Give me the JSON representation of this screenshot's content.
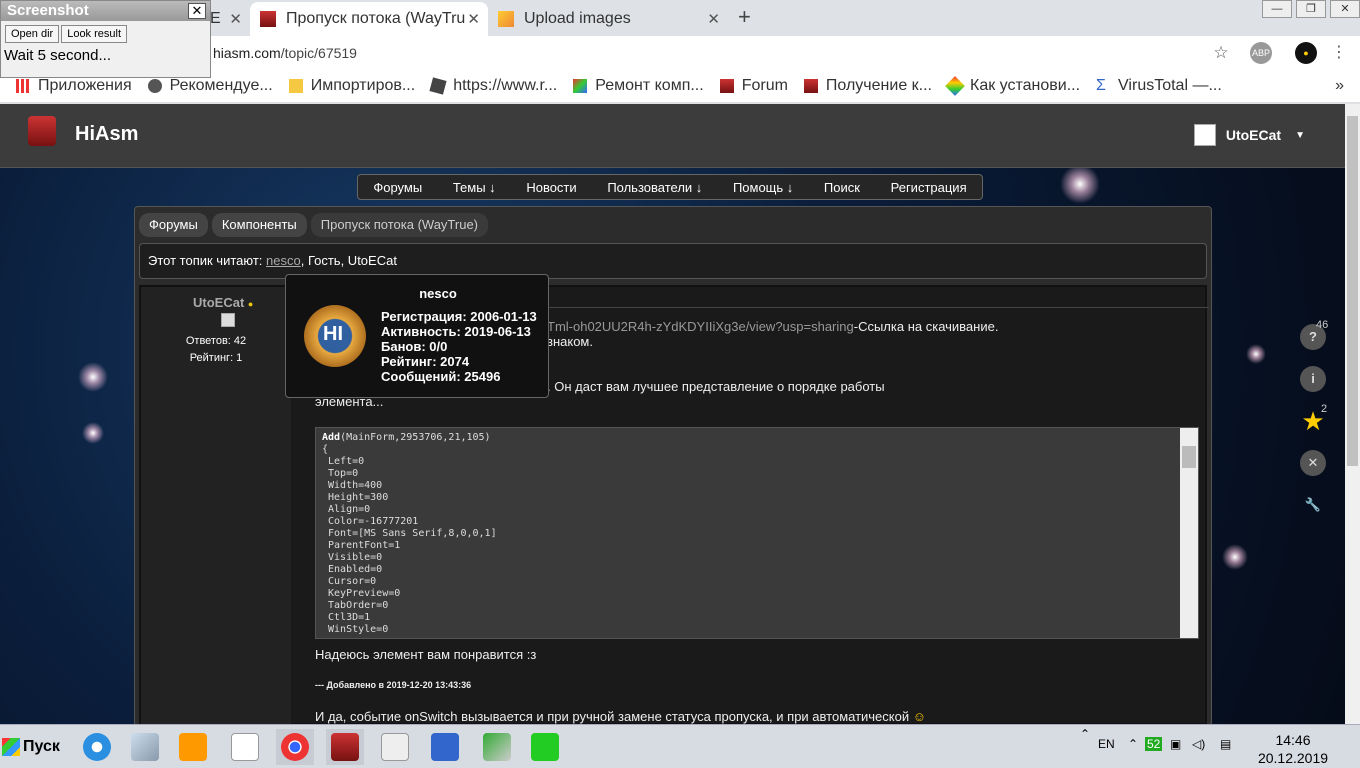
{
  "browser": {
    "tabs": [
      {
        "label": "E",
        "partial": true
      },
      {
        "label": "Пропуск потока (WayTru"
      },
      {
        "label": "Upload images"
      }
    ],
    "url_prefix": "hiasm.com",
    "url_path": "/topic/67519",
    "abp_label": "ABP",
    "bookmarks": [
      "Приложения",
      "Рекомендуе...",
      "Импортиров...",
      "https://www.r...",
      "Ремонт комп...",
      "Forum",
      "Получение к...",
      "Как установи...",
      "VirusTotal —..."
    ],
    "more_bookmarks": "»"
  },
  "screenshot_tool": {
    "title": "Screenshot",
    "open_dir": "Open dir",
    "look_result": "Look result",
    "status": "Wait 5 second..."
  },
  "site": {
    "brand": "HiAsm",
    "user": "UtoECat",
    "user_caret": "▼",
    "nav": [
      "Форумы",
      "Темы ↓",
      "Новости",
      "Пользователи ↓",
      "Помощь ↓",
      "Поиск",
      "Регистрация"
    ],
    "breadcrumbs": [
      "Форумы",
      "Компоненты",
      "Пропуск потока (WayTrue)"
    ],
    "readers_label": "Этот топик читают:",
    "readers_link": "nesco",
    "readers_rest": ", Гость, UtoECat"
  },
  "post": {
    "author": "UtoECat",
    "answers": "Ответов: 42",
    "rating": "Рейтинг: 1",
    "link_text": "Tml-oh02UU2R4h-zYdKDYIIiXg3e/view?usp=sharing",
    "line1_rest": "-Ссылка на скачивание.",
    "line2": "знаком.",
    "line3": ". Он даст вам лучшее представление о порядке работы",
    "line4": "элемента...",
    "code_first": "Add",
    "code_first_rest": "(MainForm,2953706,21,105)",
    "code_lines": [
      "{",
      " Left=0",
      " Top=0",
      " Width=400",
      " Height=300",
      " Align=0",
      " Color=-16777201",
      " Font=[MS Sans Serif,8,0,0,1]",
      " ParentFont=1",
      " Visible=0",
      " Enabled=0",
      " Cursor=0",
      " KeyPreview=0",
      " TabOrder=0",
      " Ctl3D=1",
      " WinStyle=0"
    ],
    "after1": "Надеюсь элемент вам понравится :з",
    "added": "--- Добавлено в 2019-12-20 13:43:36",
    "after2": "И да, событие onSwitch вызывается и при ручной замене статуса пропуска, и при автоматической"
  },
  "tooltip": {
    "name": "nesco",
    "medal": "HI",
    "reg": "Регистрация: 2006-01-13",
    "activity": "Активность: 2019-06-13",
    "bans": "Банов: 0/0",
    "rating": "Рейтинг: 2074",
    "messages": "Сообщений: 25496"
  },
  "side": {
    "star_count": "46",
    "tool_count": "2"
  },
  "taskbar": {
    "start": "Пуск",
    "lang": "EN",
    "badge": "52",
    "time": "14:46",
    "date": "20.12.2019"
  }
}
